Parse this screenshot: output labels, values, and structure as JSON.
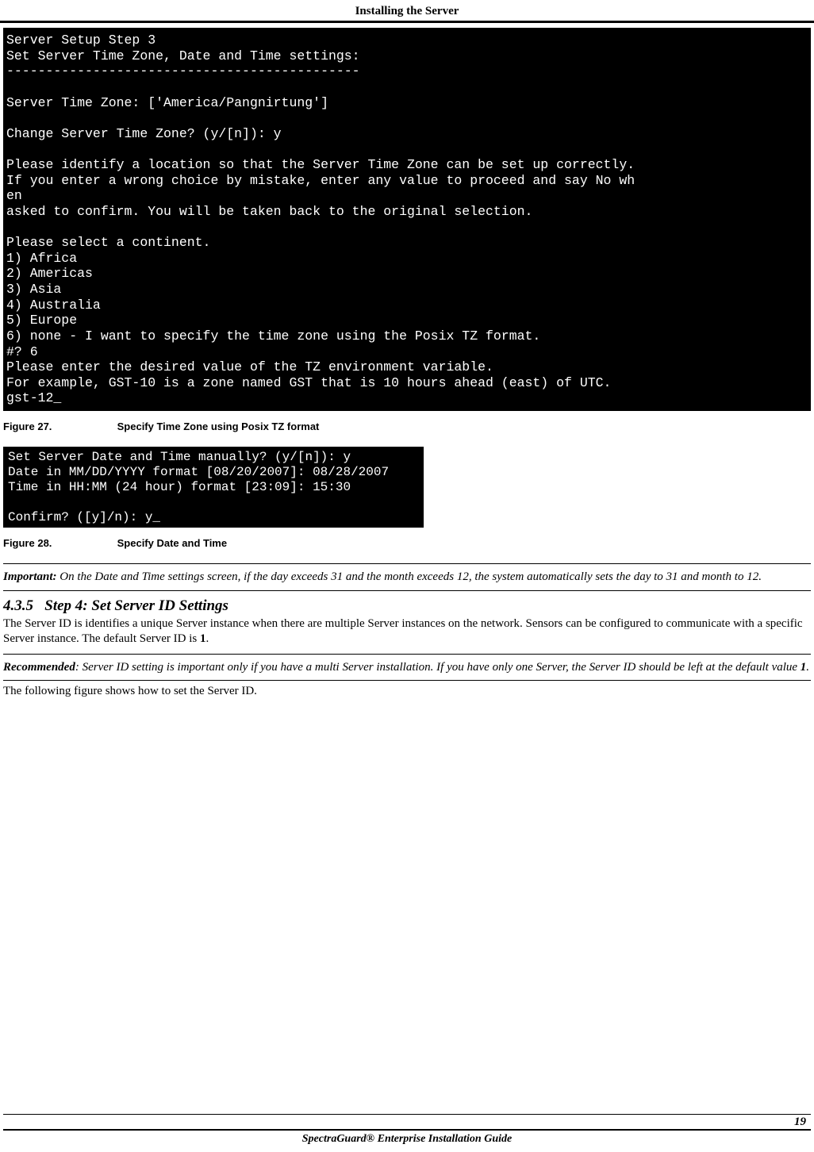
{
  "header": {
    "title": "Installing the Server"
  },
  "terminal1": {
    "lines": [
      "Server Setup Step 3",
      "Set Server Time Zone, Date and Time settings:",
      "---------------------------------------------",
      "",
      "Server Time Zone: ['America/Pangnirtung']",
      "",
      "Change Server Time Zone? (y/[n]): y",
      "",
      "Please identify a location so that the Server Time Zone can be set up correctly.",
      "If you enter a wrong choice by mistake, enter any value to proceed and say No wh",
      "en",
      "asked to confirm. You will be taken back to the original selection.",
      "",
      "Please select a continent.",
      "1) Africa",
      "2) Americas",
      "3) Asia",
      "4) Australia",
      "5) Europe",
      "6) none - I want to specify the time zone using the Posix TZ format.",
      "#? 6",
      "Please enter the desired value of the TZ environment variable.",
      "For example, GST-10 is a zone named GST that is 10 hours ahead (east) of UTC.",
      "gst-12_"
    ]
  },
  "figure27": {
    "num": "Figure  27.",
    "title": "Specify Time Zone using Posix TZ format"
  },
  "terminal2": {
    "lines": [
      "Set Server Date and Time manually? (y/[n]): y",
      "Date in MM/DD/YYYY format [08/20/2007]: 08/28/2007",
      "Time in HH:MM (24 hour) format [23:09]: 15:30",
      "",
      "Confirm? ([y]/n): y_"
    ]
  },
  "figure28": {
    "num": "Figure  28.",
    "title": "Specify Date and Time"
  },
  "important": {
    "label": "Important:",
    "text": " On the Date and Time settings screen, if the day exceeds 31 and the month exceeds 12, the system automatically sets the day to 31 and month to 12."
  },
  "section": {
    "number": "4.3.5",
    "title": "Step 4: Set Server ID Settings"
  },
  "para1_a": "The Server ID is identifies a unique Server instance when there are multiple Server instances on the network. Sensors can be configured to communicate with a specific Server instance. The default Server ID is ",
  "para1_bold": "1",
  "para1_b": ".",
  "recommended": {
    "label": "Recommended",
    "text_a": ": Server ID setting is important only if you have a multi Server installation. If you have only one Server, the Server ID should be left at the default value ",
    "bold": "1",
    "text_b": "."
  },
  "para2": "The following figure shows how to set the Server ID.",
  "footer": {
    "pagenum": "19",
    "guide": "SpectraGuard® Enterprise Installation Guide"
  }
}
